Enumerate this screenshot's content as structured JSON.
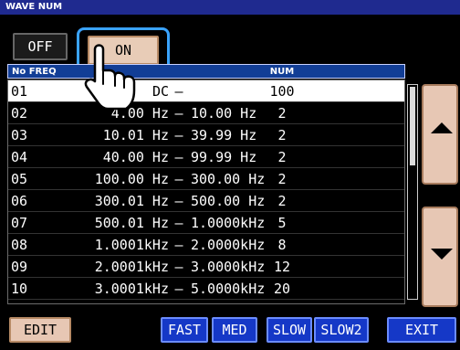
{
  "window": {
    "title": "WAVE NUM"
  },
  "toggle": {
    "off_label": "OFF",
    "on_label": "ON"
  },
  "table": {
    "header_no_freq": "No FREQ",
    "header_num": "NUM",
    "rows": [
      {
        "no": "01",
        "f_from": "DC",
        "dash": "–",
        "f_to": "",
        "num": "100",
        "selected": true
      },
      {
        "no": "02",
        "f_from": "4.00 Hz",
        "dash": "–",
        "f_to": "10.00 Hz",
        "num": "2",
        "selected": false
      },
      {
        "no": "03",
        "f_from": "10.01 Hz",
        "dash": "–",
        "f_to": "39.99 Hz",
        "num": "2",
        "selected": false
      },
      {
        "no": "04",
        "f_from": "40.00 Hz",
        "dash": "–",
        "f_to": "99.99 Hz",
        "num": "2",
        "selected": false
      },
      {
        "no": "05",
        "f_from": "100.00 Hz",
        "dash": "–",
        "f_to": "300.00 Hz",
        "num": "2",
        "selected": false
      },
      {
        "no": "06",
        "f_from": "300.01 Hz",
        "dash": "–",
        "f_to": "500.00 Hz",
        "num": "2",
        "selected": false
      },
      {
        "no": "07",
        "f_from": "500.01 Hz",
        "dash": "–",
        "f_to": "1.0000kHz",
        "num": "5",
        "selected": false
      },
      {
        "no": "08",
        "f_from": "1.0001kHz",
        "dash": "–",
        "f_to": "2.0000kHz",
        "num": "8",
        "selected": false
      },
      {
        "no": "09",
        "f_from": "2.0001kHz",
        "dash": "–",
        "f_to": "3.0000kHz",
        "num": "12",
        "selected": false
      },
      {
        "no": "10",
        "f_from": "3.0001kHz",
        "dash": "–",
        "f_to": "5.0000kHz",
        "num": "20",
        "selected": false
      }
    ]
  },
  "scroll": {
    "up_icon": "triangle-up-icon",
    "down_icon": "triangle-down-icon"
  },
  "bottom": {
    "edit": "EDIT",
    "fast": "FAST",
    "med": "MED",
    "slow": "SLOW",
    "slow2": "SLOW2",
    "exit": "EXIT"
  },
  "colors": {
    "title_bg": "#1f2a8f",
    "highlight": "#3aa3ff",
    "on_button": "#e8ccb7",
    "blue_button": "#1538c7"
  }
}
